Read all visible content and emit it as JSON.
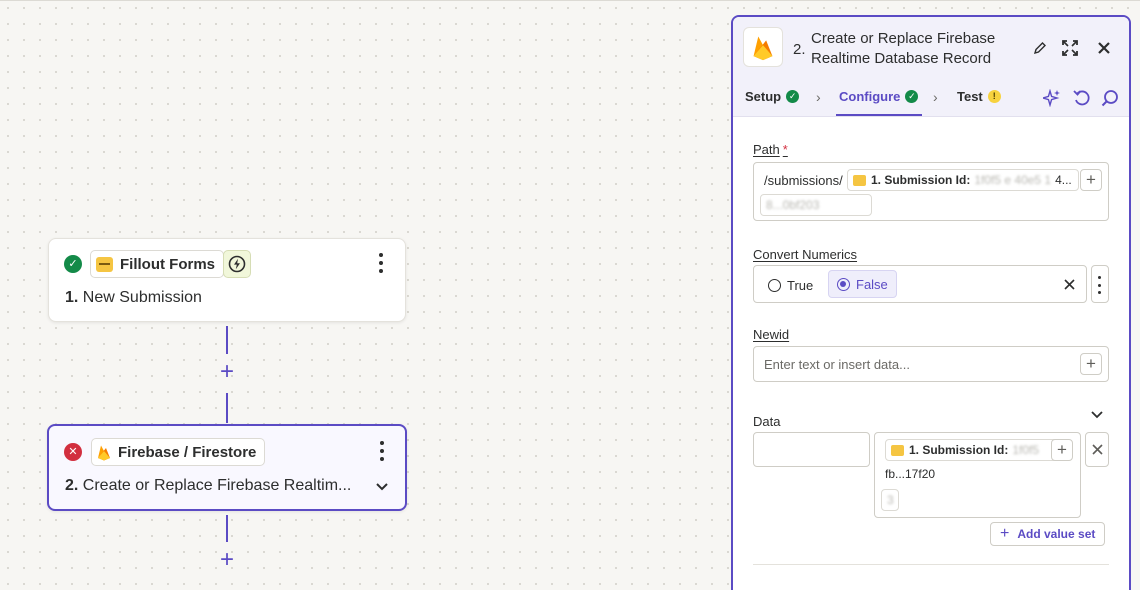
{
  "canvas": {
    "steps": [
      {
        "status": "success",
        "app_name": "Fillout Forms",
        "number": "1.",
        "title": "New Submission",
        "trigger_icon": "bolt-icon"
      },
      {
        "status": "error",
        "app_name": "Firebase / Firestore",
        "number": "2.",
        "title": "Create or Replace Firebase Realtim..."
      }
    ],
    "add_step_symbol": "+"
  },
  "panel": {
    "header": {
      "number": "2.",
      "title": "Create or Replace Firebase Realtime Database Record",
      "icons": [
        "pencil-icon",
        "expand-icon",
        "close-icon"
      ]
    },
    "tabs": [
      {
        "label": "Setup",
        "status": "ok"
      },
      {
        "label": "Configure",
        "status": "ok",
        "active": true
      },
      {
        "label": "Test",
        "status": "warning"
      }
    ],
    "tab_tools": [
      "ai-sparkle-icon",
      "undo-icon",
      "search-icon"
    ],
    "fields": {
      "path": {
        "label": "Path",
        "required_mark": "*",
        "prefix": "/submissions/",
        "pill_label": "1. Submission Id:",
        "pill_value_visible": "4...",
        "wrapped_value": "8...0bf203"
      },
      "convert_numerics": {
        "label": "Convert Numerics",
        "options": [
          "True",
          "False"
        ],
        "selected": "False",
        "clear_icon": "close-icon"
      },
      "newid": {
        "label": "Newid",
        "placeholder": "Enter text or insert data..."
      },
      "data": {
        "label": "Data",
        "key_value": "",
        "pill_label": "1. Submission Id:",
        "value_line2": "fb...17f20",
        "value_line3": "3",
        "add_value_set_label": "Add value set"
      }
    }
  },
  "colors": {
    "accent": "#5b4bc4",
    "success": "#138a48",
    "error": "#d22f3f",
    "warning": "#f7d23e"
  }
}
